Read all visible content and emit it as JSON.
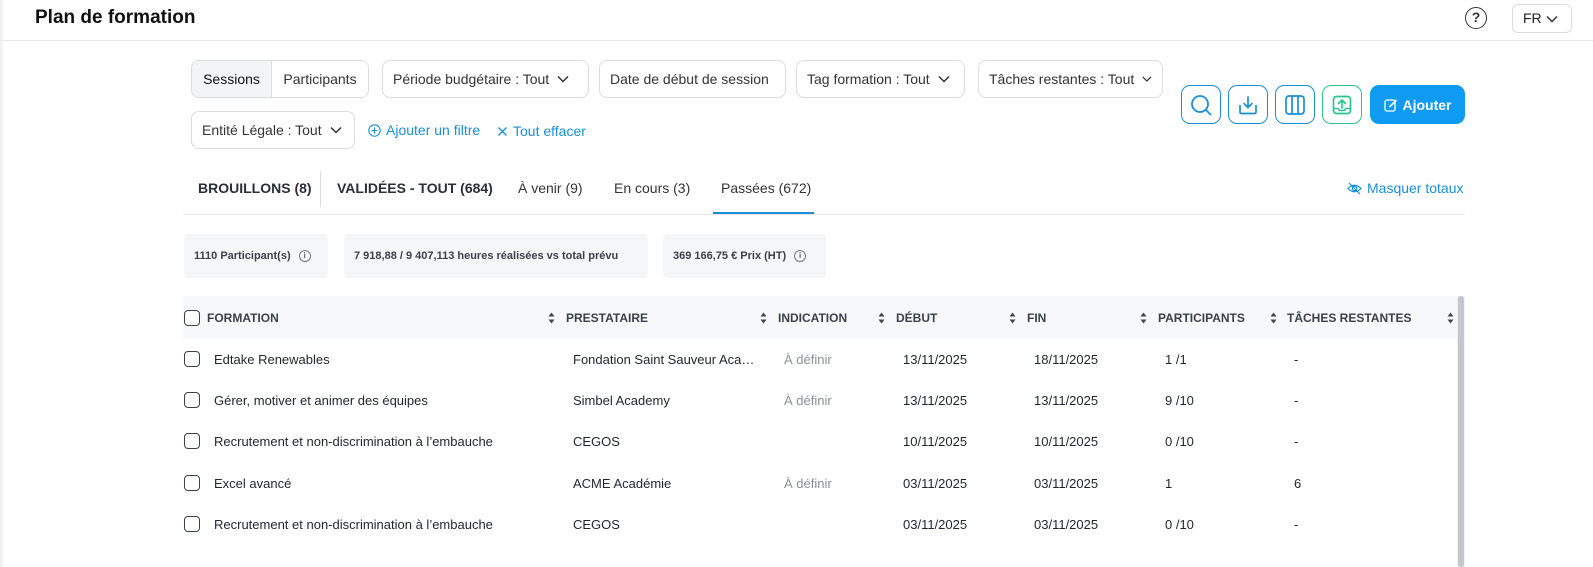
{
  "header": {
    "title": "Plan de formation",
    "help": "?",
    "lang": "FR"
  },
  "filters": {
    "seg_sessions": "Sessions",
    "seg_participants": "Participants",
    "budget": "Période budgétaire :  Tout",
    "start_date": "Date de début de session",
    "tag": "Tag formation :  Tout",
    "tasks": "Tâches restantes :  Tout",
    "entity": "Entité Légale :  Tout",
    "add_filter": "Ajouter un filtre",
    "clear_all": "Tout effacer"
  },
  "toolbar": {
    "add_label": "Ajouter",
    "icons": [
      "search-icon",
      "download-icon",
      "columns-icon",
      "upload-icon",
      "edit-icon"
    ],
    "accent": "#0f9bf2",
    "green": "#2bc48a"
  },
  "tabs": [
    {
      "label": "BROUILLONS (8)"
    },
    {
      "label": "VALIDÉES - TOUT (684)"
    },
    {
      "label": "À venir (9)"
    },
    {
      "label": "En cours (3)"
    },
    {
      "label": "Passées (672)"
    }
  ],
  "hide_totals": "Masquer totaux",
  "totals": {
    "participants": "1110 Participant(s)",
    "hours": "7 918,88 / 9 407,113 heures réalisées vs total prévu",
    "price": "369 166,75 € Prix (HT)"
  },
  "table": {
    "columns": [
      "FORMATION",
      "PRESTATAIRE",
      "INDICATION",
      "DÉBUT",
      "FIN",
      "PARTICIPANTS",
      "TÂCHES RESTANTES"
    ],
    "rows": [
      {
        "formation": "Edtake Renewables",
        "prestataire": "Fondation Saint Sauveur Aca…",
        "indication": "À définir",
        "debut": "13/11/2025",
        "fin": "18/11/2025",
        "participants": "1 /1",
        "taches": "-"
      },
      {
        "formation": "Gérer, motiver et animer des équipes",
        "prestataire": "Simbel Academy",
        "indication": "À définir",
        "debut": "13/11/2025",
        "fin": "13/11/2025",
        "participants": "9 /10",
        "taches": "-"
      },
      {
        "formation": "Recrutement et non-discrimination à l’embauche",
        "prestataire": "CEGOS",
        "indication": "",
        "debut": "10/11/2025",
        "fin": "10/11/2025",
        "participants": "0 /10",
        "taches": "-"
      },
      {
        "formation": "Excel avancé",
        "prestataire": "ACME Académie",
        "indication": "À définir",
        "debut": "03/11/2025",
        "fin": "03/11/2025",
        "participants": "1",
        "taches": "6"
      },
      {
        "formation": "Recrutement et non-discrimination à l’embauche",
        "prestataire": "CEGOS",
        "indication": "",
        "debut": "03/11/2025",
        "fin": "03/11/2025",
        "participants": "0 /10",
        "taches": "-"
      }
    ]
  }
}
